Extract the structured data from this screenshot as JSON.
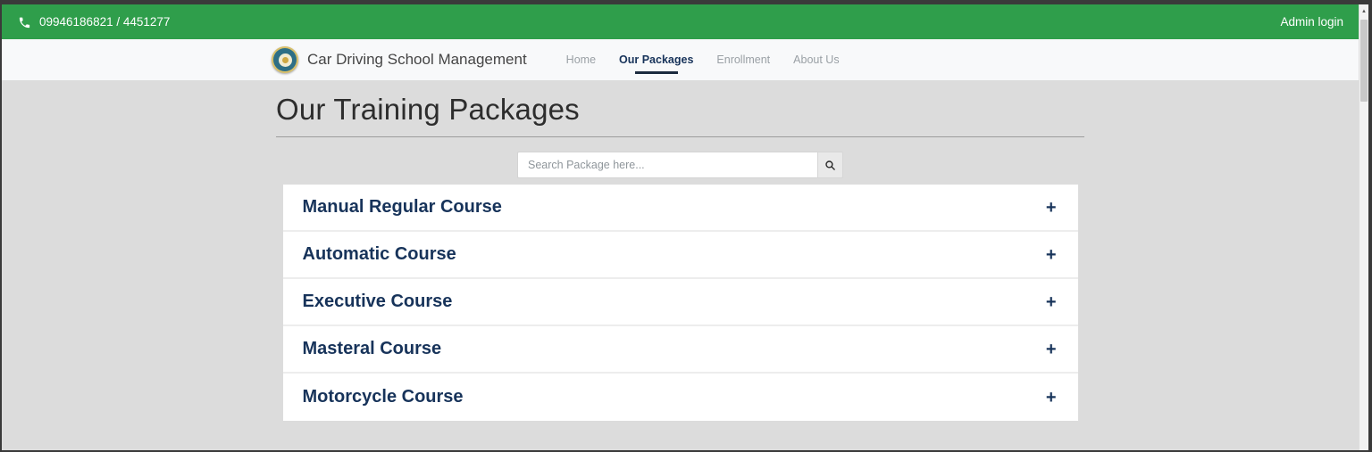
{
  "colors": {
    "accent_green": "#2f9e4b",
    "navy": "#17335a",
    "nav_active_underline": "#1c2b3e",
    "page_bg": "#dcdcdc",
    "navbar_bg": "#f8f9fa",
    "frame": "#3a3a3a"
  },
  "topbar": {
    "phone": "09946186821 / 4451277",
    "phone_icon": "phone-icon",
    "admin_login_label": "Admin login"
  },
  "navbar": {
    "brand": "Car Driving School Management",
    "logo_icon": "school-seal-icon",
    "items": [
      {
        "label": "Home",
        "active": false
      },
      {
        "label": "Our Packages",
        "active": true
      },
      {
        "label": "Enrollment",
        "active": false
      },
      {
        "label": "About Us",
        "active": false
      }
    ]
  },
  "main": {
    "title": "Our Training Packages",
    "search": {
      "placeholder": "Search Package here...",
      "value": "",
      "icon": "search-icon"
    },
    "expand_symbol": "+",
    "packages": [
      {
        "title": "Manual Regular Course",
        "expanded": false
      },
      {
        "title": "Automatic Course",
        "expanded": false
      },
      {
        "title": "Executive Course",
        "expanded": false
      },
      {
        "title": "Masteral Course",
        "expanded": false
      },
      {
        "title": "Motorcycle Course",
        "expanded": false
      }
    ]
  },
  "scrollbar": {
    "up_arrow": "▲"
  }
}
